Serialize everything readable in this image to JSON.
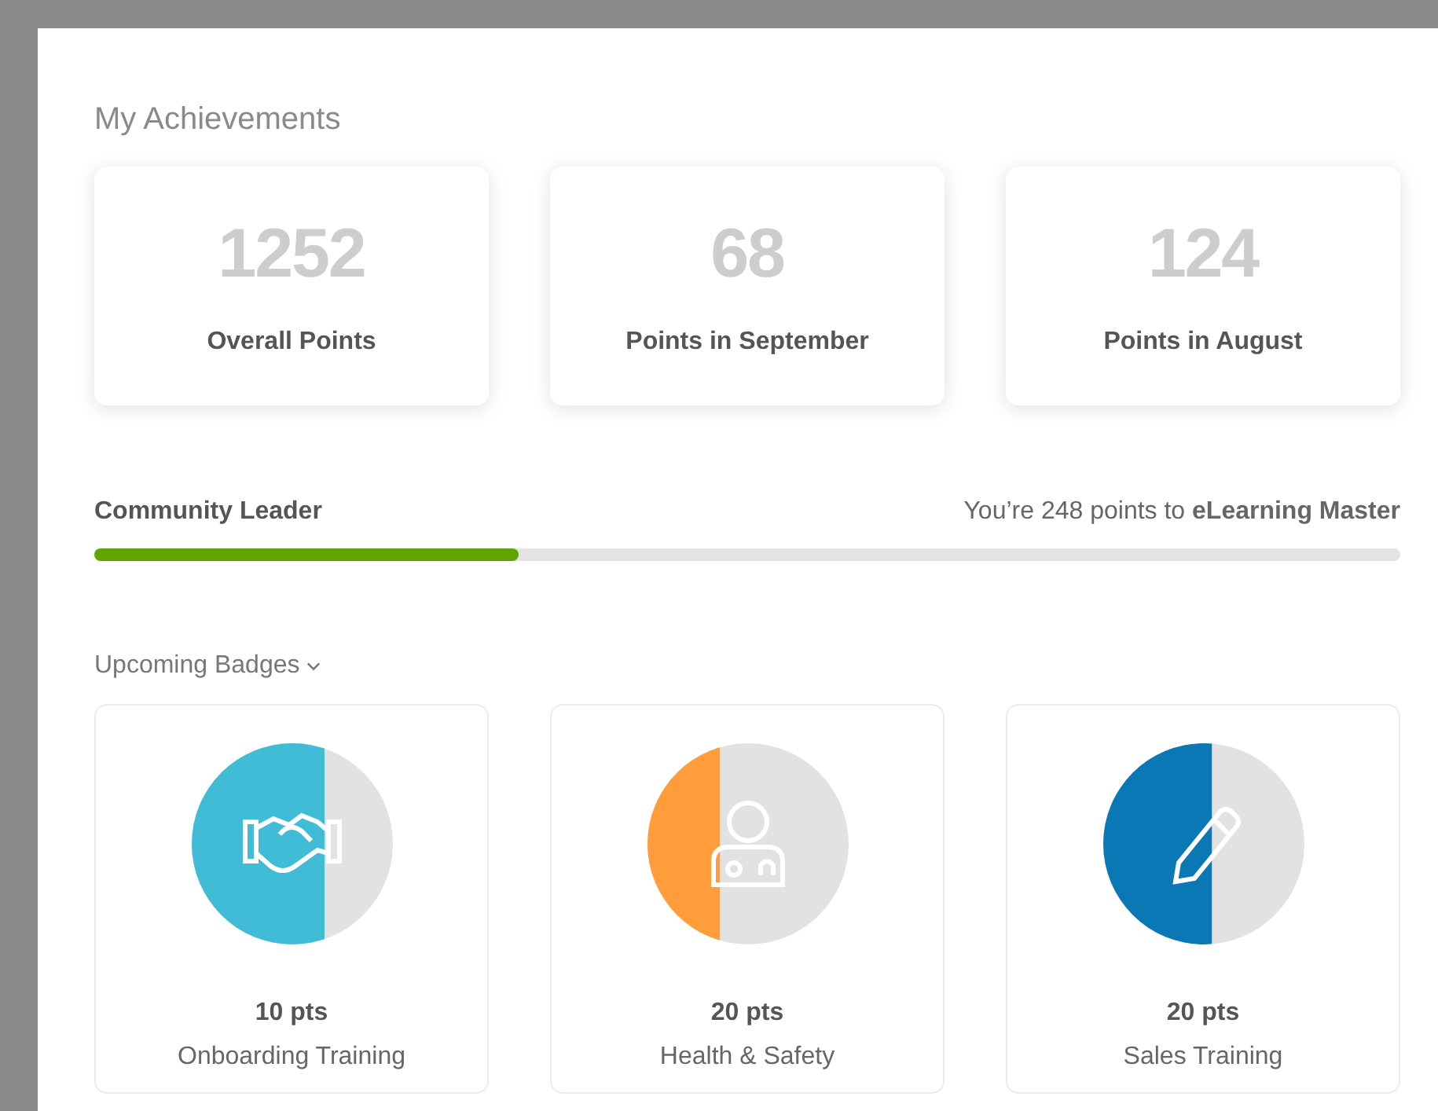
{
  "title": "My Achievements",
  "stats": [
    {
      "value": "1252",
      "label": "Overall Points"
    },
    {
      "value": "68",
      "label": "Points in September"
    },
    {
      "value": "124",
      "label": "Points in August"
    }
  ],
  "progress": {
    "current": "Community Leader",
    "next": "You’re 248 points to **eLearning Master**",
    "level": 0.325
  },
  "badges_header": {
    "label": "Upcoming Badges",
    "expanded": true
  },
  "badges": [
    {
      "points": "10 pts",
      "name": "Onboarding Training",
      "color": "#41bcd6",
      "level": 0.66
    },
    {
      "points": "20 pts",
      "name": "Health & Safety",
      "color": "#ff9d3a",
      "level": 0.36
    },
    {
      "points": "20 pts",
      "name": "Sales Training",
      "color": "#0a78b5",
      "level": 0.54
    }
  ]
}
